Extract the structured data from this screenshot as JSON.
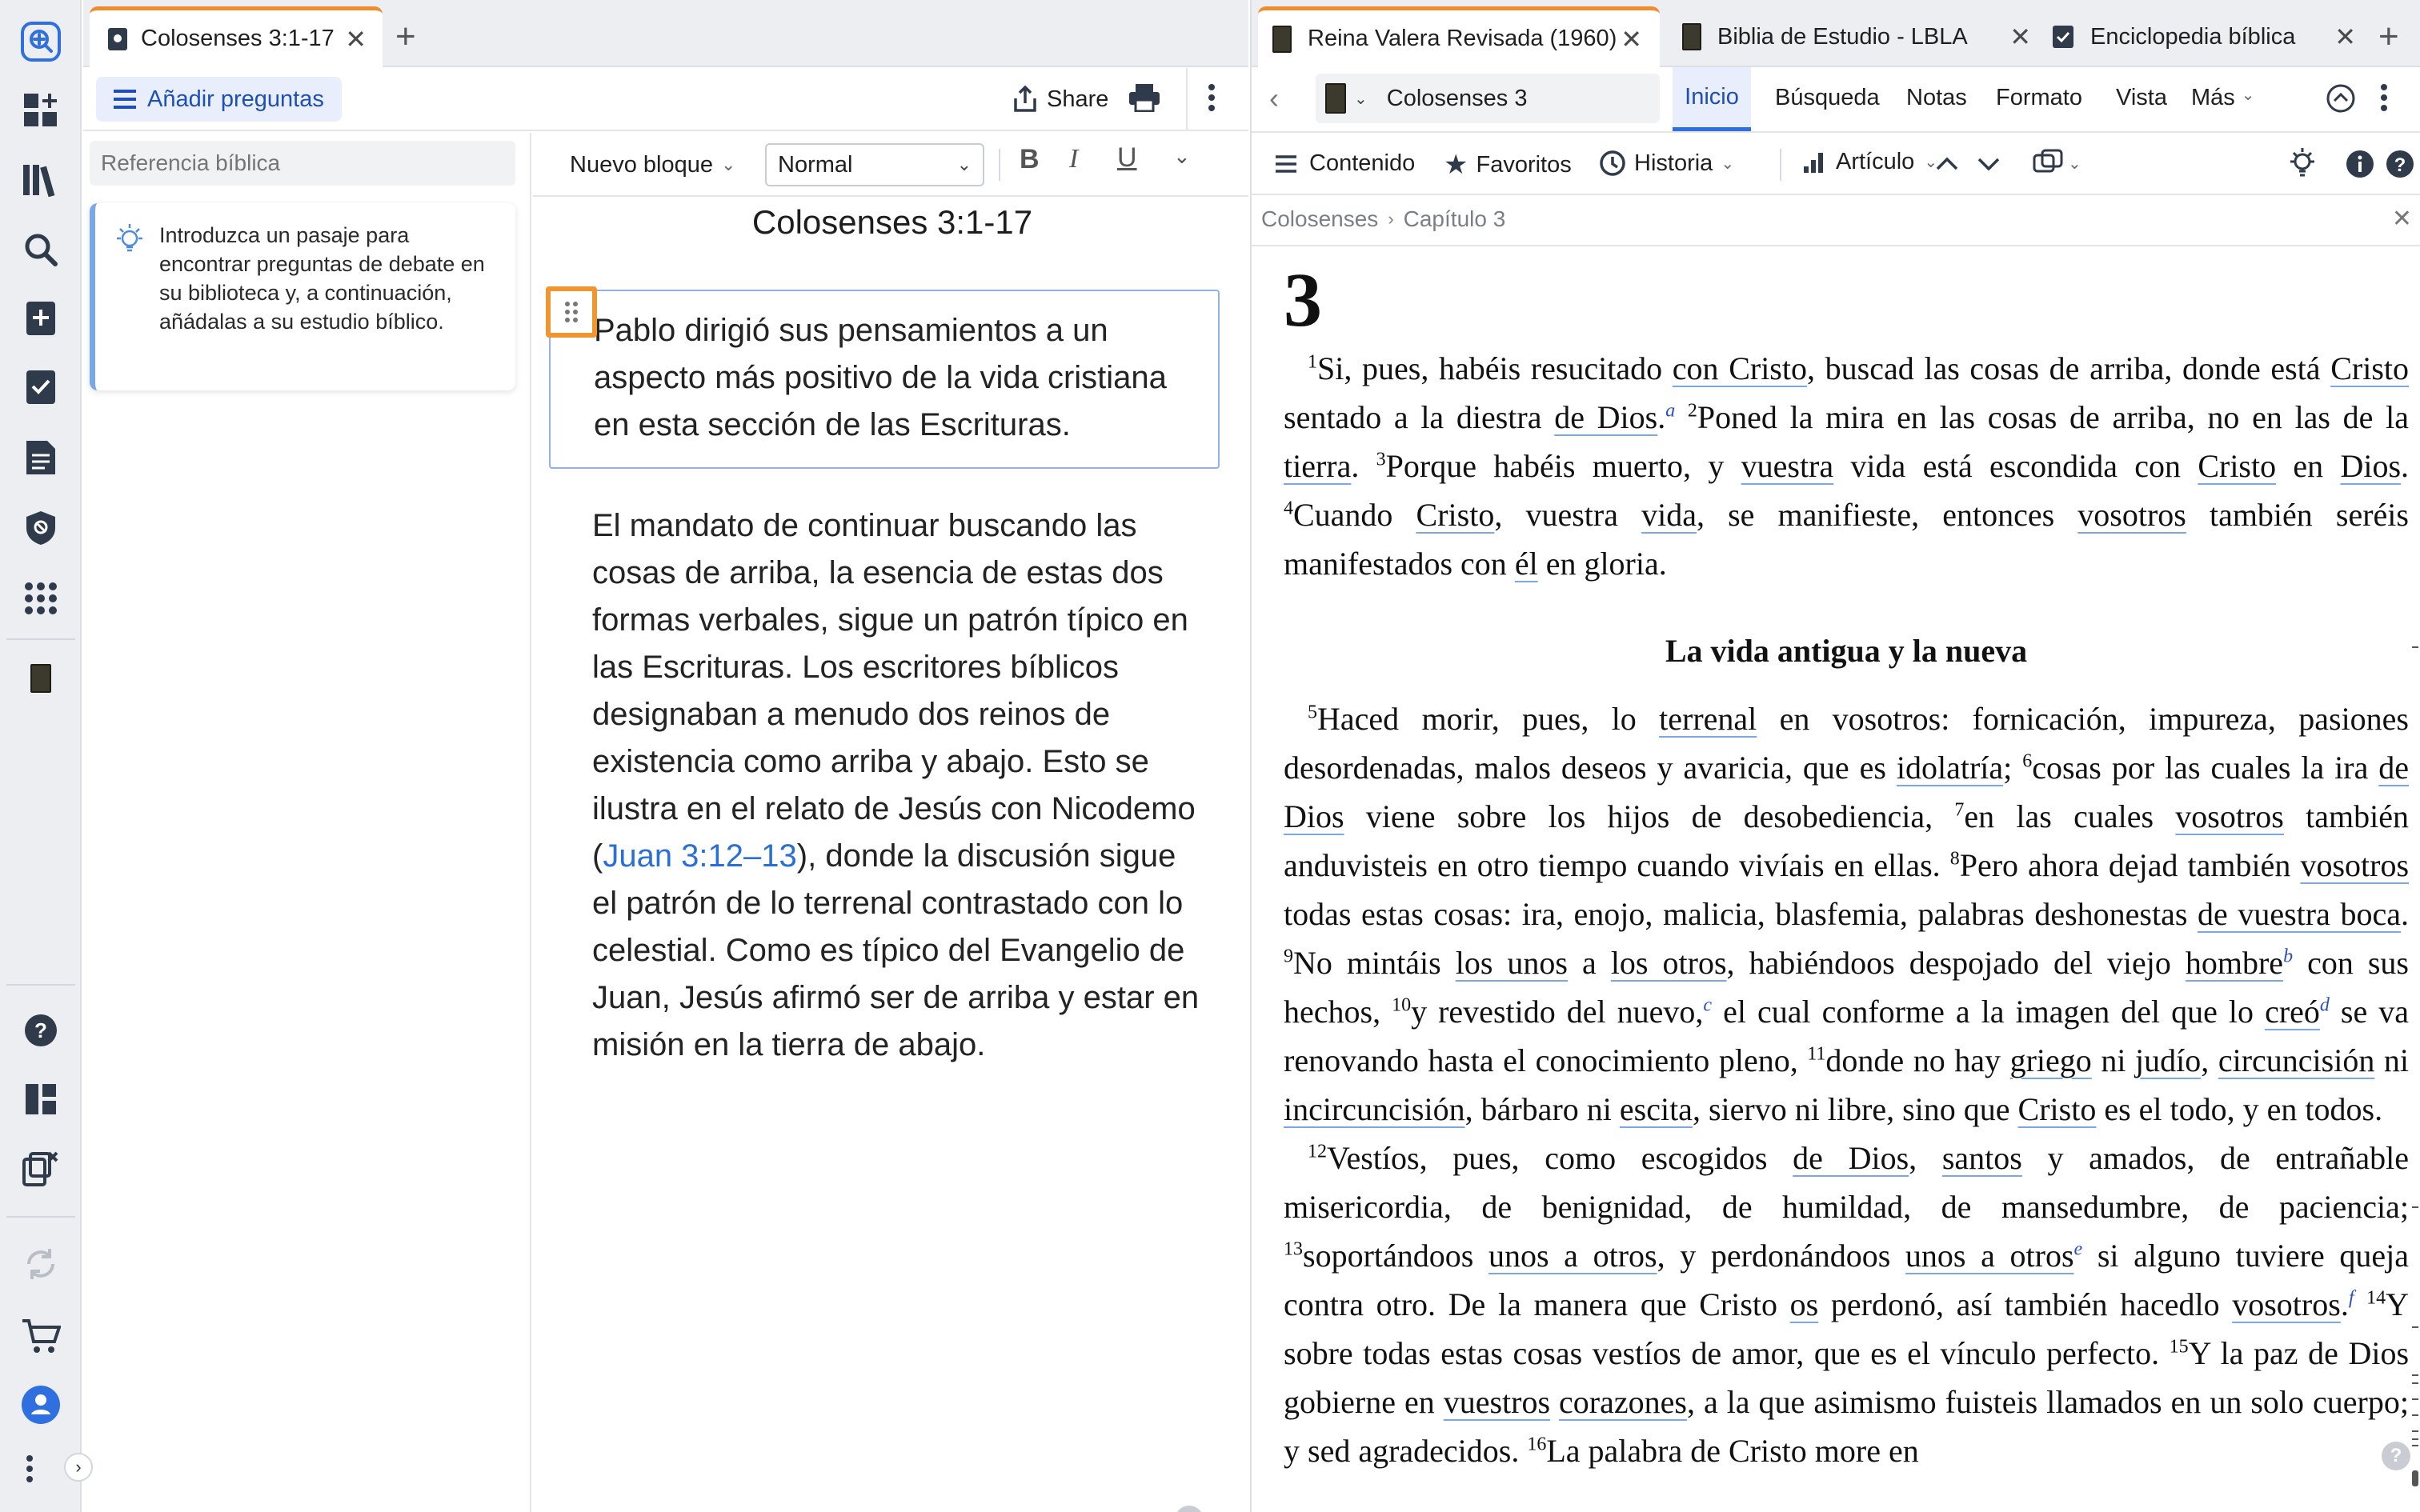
{
  "left_tabs": {
    "active_tab": "Colosenses 3:1-17",
    "add_tab": "+"
  },
  "right_tabs": {
    "tabs": [
      "Reina Valera Revisada (1960)",
      "Biblia de Estudio - LBLA",
      "Enciclopedia bíblica"
    ],
    "add_tab": "+"
  },
  "study": {
    "add_questions": "Añadir preguntas",
    "share": "Share",
    "ref_placeholder": "Referencia bíblica",
    "hint": "Introduzca un pasaje para encontrar preguntas de debate en su biblioteca y, a continuación, añádalas a su estudio bíblico."
  },
  "editor": {
    "block_type": "Nuevo bloque",
    "style": "Normal",
    "title": "Colosenses 3:1-17",
    "block1": "Pablo dirigió sus pensamientos a un aspecto más positivo de la vida cristiana en esta sección de las Escrituras.",
    "block2_a": "El mandato de continuar buscando las cosas de arriba, la esencia de estas dos formas verbales, sigue un patrón típico en las Escrituras. Los escritores bíblicos designaban a menudo dos reinos de existencia como arriba y abajo. Esto se ilustra en el relato de Jesús con Nicodemo (",
    "block2_link": "Juan 3:12–13",
    "block2_b": "), donde la discusión sigue el patrón de lo terrenal contrastado con lo celestial. Como es típico del Evangelio de Juan, Jesús afirmó ser de arriba y estar en misión en la tierra de abajo."
  },
  "bible": {
    "reference": "Colosenses 3",
    "menu": [
      "Inicio",
      "Búsqueda",
      "Notas",
      "Formato",
      "Vista",
      "Más"
    ],
    "toolbar": [
      "Contenido",
      "Favoritos",
      "Historia",
      "Artículo"
    ],
    "breadcrumb": [
      "Colosenses",
      "Capítulo 3"
    ],
    "chapter": "3",
    "heading": "La vida antigua y la nueva",
    "t": {
      "v1": "1",
      "p1a": "Si, pues, habéis resucitado ",
      "p1b": "con Cristo",
      "p1c": ", buscad las cosas de arriba, donde está ",
      "p1d": "Cristo",
      "p1e": " sentado a la diestra ",
      "p1f": "de Dios",
      "p1g": ".",
      "fa": "a",
      "v2": "2",
      "p2a": "Poned la mira en las cosas de arriba, no en las de la ",
      "p2b": "tierra",
      "p2c": ". ",
      "v3": "3",
      "p3a": "Porque habéis muerto, y ",
      "p3b": "vuestra",
      "p3c": " vida está escondida con ",
      "p3d": "Cristo",
      "p3e": " en ",
      "p3f": "Dios",
      "p3g": ". ",
      "v4": "4",
      "p4a": "Cuando ",
      "p4b": "Cristo",
      "p4c": ", vuestra ",
      "p4d": "vida",
      "p4e": ", se manifieste, entonces ",
      "p4f": "vosotros",
      "p4g": " también seréis manifestados con ",
      "p4h": "él",
      "p4i": " en gloria.",
      "v5": "5",
      "p5a": "Haced morir, pues, lo ",
      "p5b": "terrenal",
      "p5c": " en vosotros: fornicación, impureza, pasiones desordenadas, malos deseos y avaricia, que es ",
      "p5d": "idolatría",
      "p5e": ";",
      "v6": "6",
      "p6a": "cosas por las cuales la ira ",
      "p6b": "de Dios",
      "p6c": " viene sobre los hijos de desobediencia, ",
      "v7": "7",
      "p7a": "en las cuales ",
      "p7b": "vosotros",
      "p7c": " también anduvisteis en otro tiempo cuando vivíais en ellas. ",
      "v8": "8",
      "p8a": "Pero ahora dejad también ",
      "p8b": "vosotros",
      "p8c": " todas estas cosas: ira, enojo, malicia, blasfemia, palabras deshonestas ",
      "p8d": "de vuestra boca",
      "p8e": ". ",
      "v9": "9",
      "p9a": "No mintáis ",
      "p9b": "los unos",
      "p9c": " a ",
      "p9d": "los otros",
      "p9e": ", habiéndoos despojado del viejo ",
      "p9f": "hombre",
      "fb": "b",
      "p9g": " con sus hechos, ",
      "v10": "10",
      "p10a": "y revestido del nuevo,",
      "fc": "c",
      "p10b": " el cual conforme a la imagen del que lo ",
      "p10c": "creó",
      "fd": "d",
      "p10d": " se va renovando hasta el conocimiento pleno, ",
      "v11": "11",
      "p11a": "donde no hay ",
      "p11b": "griego",
      "p11c": " ni ",
      "p11d": "judío",
      "p11e": ", ",
      "p11f": "circuncisión",
      "p11g": " ni ",
      "p11h": "incircuncisión",
      "p11i": ", bárbaro ni ",
      "p11j": "escita",
      "p11k": ", siervo ni libre, sino que ",
      "p11l": "Cristo",
      "p11m": " es el todo, y en todos.",
      "v12": "12",
      "p12a": "Vestíos, pues, como escogidos ",
      "p12b": "de Dios",
      "p12c": ", ",
      "p12d": "santos",
      "p12e": " y amados, de entrañable misericordia, de benignidad, de humildad, de mansedumbre, de paciencia;",
      "v13": "13",
      "p13a": "soportándoos ",
      "p13b": "unos a otros",
      "p13c": ", y perdonándoos ",
      "p13d": "unos a otros",
      "fe": "e",
      "p13e": " si alguno tuviere queja contra otro. De la manera que Cristo ",
      "p13f": "os",
      "p13g": " perdonó, así también hacedlo ",
      "p13h": "vosotros",
      "p13i": ".",
      "ff": "f",
      "p13j": " ",
      "v14": "14",
      "p14a": "Y sobre todas estas cosas vestíos de amor, que es el vínculo perfecto.",
      "v15": "15",
      "p15a": "Y la paz de Dios gobierne en ",
      "p15b": "vuestros",
      "p15c": " ",
      "p15d": "corazones",
      "p15e": ", a la que asimismo fuisteis llamados en un solo cuerpo; y sed agradecidos. ",
      "v16": "16",
      "p16a": "La palabra de Cristo more en"
    }
  },
  "colors": {
    "accent_orange": "#f08c2c",
    "link_blue": "#2a6fd6",
    "rail_blue": "#2f6fe0"
  }
}
